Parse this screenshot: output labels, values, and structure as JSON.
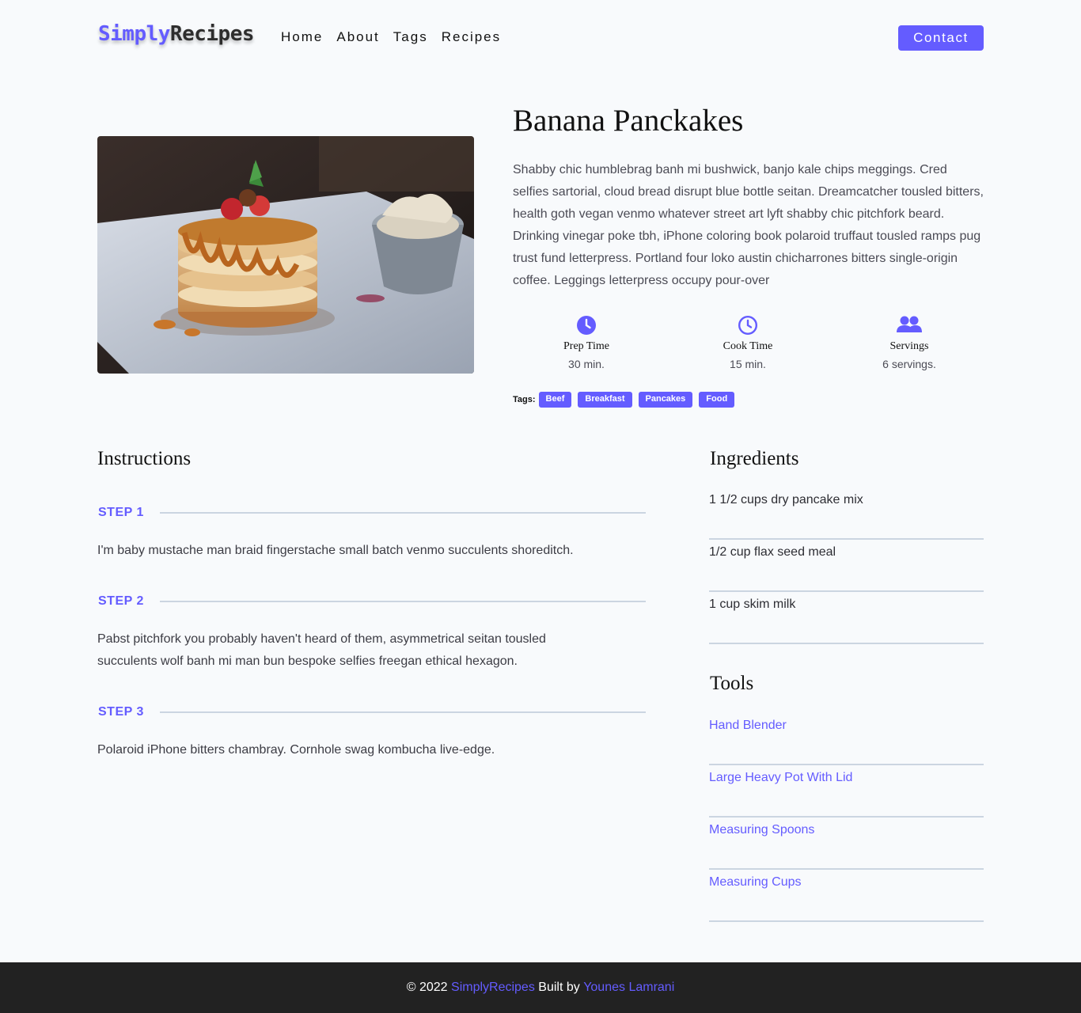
{
  "brand": {
    "part1": "Simply",
    "part2": "Recipes"
  },
  "nav": {
    "links": [
      "Home",
      "About",
      "Tags",
      "Recipes"
    ],
    "contact_label": "Contact"
  },
  "colors": {
    "accent": "#645cff",
    "footer_bg": "#222222"
  },
  "recipe": {
    "title": "Banana Panckakes",
    "description": "Shabby chic humblebrag banh mi bushwick, banjo kale chips meggings. Cred selfies sartorial, cloud bread disrupt blue bottle seitan. Dreamcatcher tousled bitters, health goth vegan venmo whatever street art lyft shabby chic pitchfork beard. Drinking vinegar poke tbh, iPhone coloring book polaroid truffaut tousled ramps pug trust fund letterpress. Portland four loko austin chicharrones bitters single-origin coffee. Leggings letterpress occupy pour-over",
    "stats": [
      {
        "icon": "clock-filled-icon",
        "label": "Prep Time",
        "value": "30 min."
      },
      {
        "icon": "clock-outline-icon",
        "label": "Cook Time",
        "value": "15 min."
      },
      {
        "icon": "users-icon",
        "label": "Servings",
        "value": "6 servings."
      }
    ],
    "tags_label": "Tags:",
    "tags": [
      "Beef",
      "Breakfast",
      "Pancakes",
      "Food"
    ]
  },
  "instructions": {
    "heading": "Instructions",
    "steps": [
      {
        "label": "STEP 1",
        "text": "I'm baby mustache man braid fingerstache small batch venmo succulents shoreditch."
      },
      {
        "label": "STEP 2",
        "text": "Pabst pitchfork you probably haven't heard of them, asymmetrical seitan tousled succulents wolf banh mi man bun bespoke selfies freegan ethical hexagon."
      },
      {
        "label": "STEP 3",
        "text": "Polaroid iPhone bitters chambray. Cornhole swag kombucha live-edge."
      }
    ]
  },
  "ingredients": {
    "heading": "Ingredients",
    "items": [
      "1 1/2 cups dry pancake mix",
      "1/2 cup flax seed meal",
      "1 cup skim milk"
    ]
  },
  "tools": {
    "heading": "Tools",
    "items": [
      "Hand Blender",
      "Large Heavy Pot With Lid",
      "Measuring Spoons",
      "Measuring Cups"
    ]
  },
  "footer": {
    "copyright": "© 2022",
    "brand": "SimplyRecipes",
    "built_by": "Built by",
    "author": "Younes Lamrani"
  }
}
